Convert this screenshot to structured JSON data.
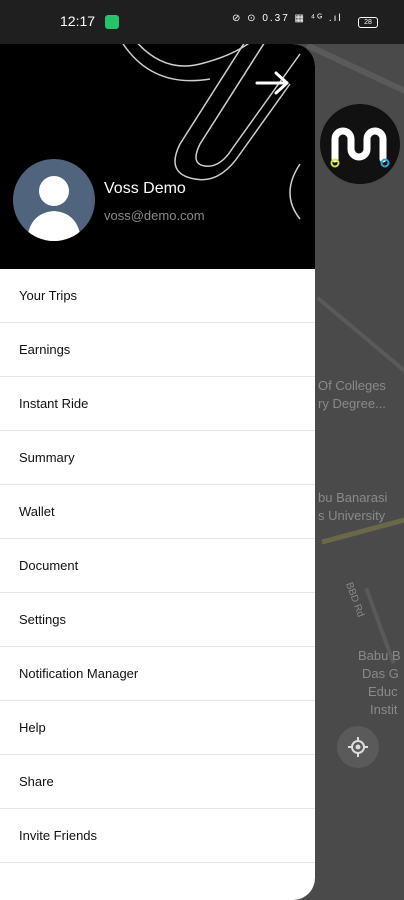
{
  "status_bar": {
    "time": "12:17",
    "system_icons": "⊘ ⊙ 0.37 ▦ ⁴ᴳ .ıl",
    "battery": "28"
  },
  "map": {
    "labels": [
      "Of Colleges",
      "ry Degree...",
      "bu Banarasi",
      "s University",
      "BBD Rd",
      "Babu B",
      "Das G",
      "Educ",
      "Instit"
    ]
  },
  "drawer": {
    "user": {
      "name": "Voss Demo",
      "email": "voss@demo.com"
    },
    "menu": [
      "Your Trips",
      "Earnings",
      "Instant Ride",
      "Summary",
      "Wallet",
      "Document",
      "Settings",
      "Notification Manager",
      "Help",
      "Share",
      "Invite Friends"
    ]
  },
  "colors": {
    "header_bg": "#000000",
    "avatar_bg": "#51647e",
    "map_bg": "#4a4a4a",
    "logo_yellow": "#d8e23a",
    "logo_blue": "#2fa6d8"
  }
}
